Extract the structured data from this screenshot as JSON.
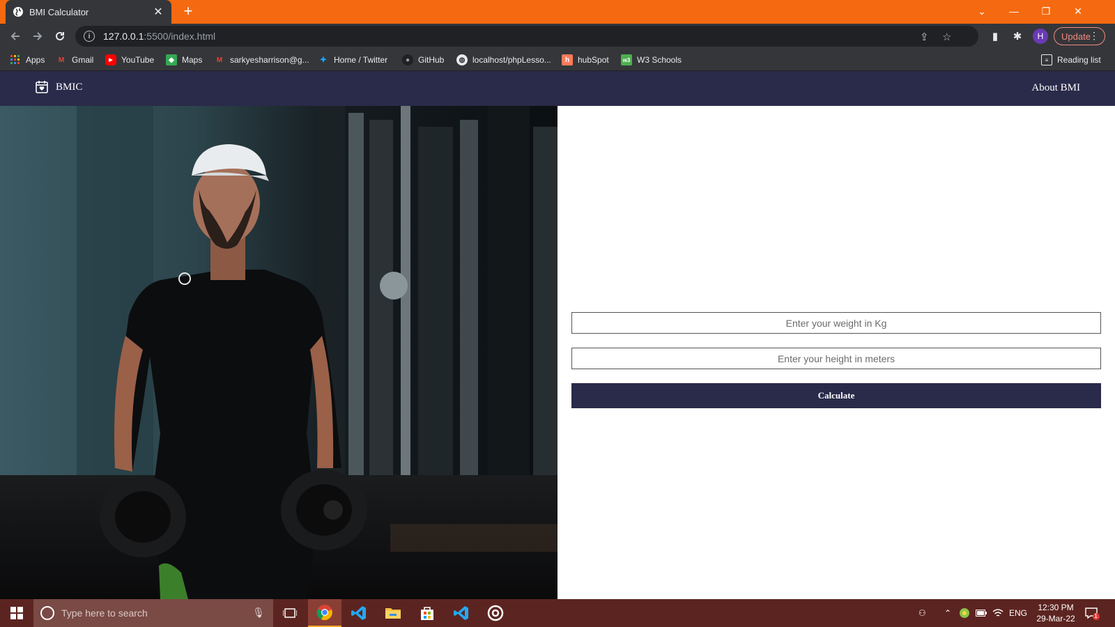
{
  "browser": {
    "tab": {
      "title": "BMI Calculator",
      "close_glyph": "✕"
    },
    "new_tab_glyph": "+",
    "url": {
      "host": "127.0.0.1",
      "path": ":5500/index.html"
    },
    "update_label": "Update",
    "profile_initial": "H",
    "window_controls": [
      "⌄",
      "—",
      "❐",
      "✕"
    ],
    "bookmarks": [
      {
        "label": "Apps",
        "icon": "apps-grid-icon"
      },
      {
        "label": "Gmail",
        "icon": "gmail-icon"
      },
      {
        "label": "YouTube",
        "icon": "youtube-icon"
      },
      {
        "label": "Maps",
        "icon": "maps-icon"
      },
      {
        "label": "sarkyesharrison@g...",
        "icon": "gmail-icon"
      },
      {
        "label": "Home / Twitter",
        "icon": "twitter-icon"
      },
      {
        "label": "GitHub",
        "icon": "github-icon"
      },
      {
        "label": "localhost/phpLesso...",
        "icon": "globe-icon"
      },
      {
        "label": "hubSpot",
        "icon": "hubspot-icon"
      },
      {
        "label": "W3 Schools",
        "icon": "w3schools-icon"
      }
    ],
    "reading_list": "Reading list"
  },
  "page": {
    "brand": "BMIC",
    "nav_about": "About BMI",
    "form": {
      "weight_placeholder": "Enter your weight in Kg",
      "height_placeholder": "Enter your height in meters",
      "calculate_label": "Calculate"
    }
  },
  "taskbar": {
    "search_placeholder": "Type here to search",
    "language": "ENG",
    "time": "12:30 PM",
    "date": "29-Mar-22",
    "notification_count": "1"
  },
  "colors": {
    "tabstrip": "#f56a10",
    "navbar": "#2a2a4a",
    "button": "#2a2a4a",
    "taskbar": "#5c2420"
  }
}
